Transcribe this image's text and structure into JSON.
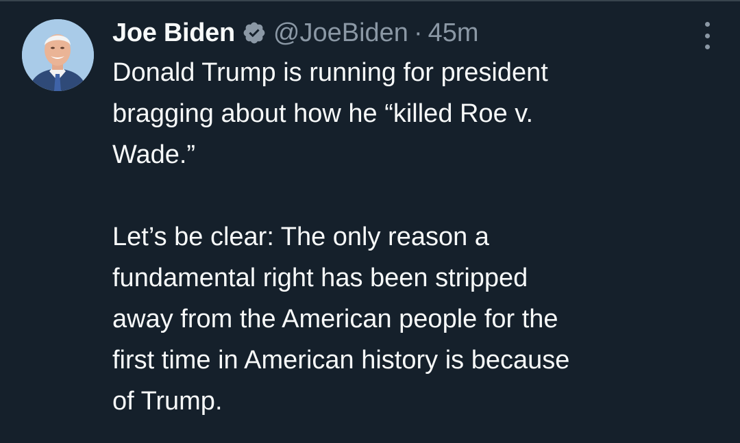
{
  "tweet": {
    "author_name": "Joe Biden",
    "handle": "@JoeBiden",
    "separator": "·",
    "time": "45m",
    "paragraphs": [
      [
        "Donald Trump is running for president",
        "bragging about how he “killed Roe v.",
        "Wade.”"
      ],
      [
        "Let’s be clear: The only reason a",
        "fundamental right has been stripped",
        "away from the American people for the",
        "first time in American history is because",
        "of Trump."
      ]
    ]
  },
  "icons": {
    "verified": "verified-badge-icon",
    "more": "more-options-icon"
  },
  "colors": {
    "background": "#15202b",
    "text": "#f7f9f9",
    "secondary_text": "#8b98a5",
    "verified_badge": "#8b98a5"
  }
}
